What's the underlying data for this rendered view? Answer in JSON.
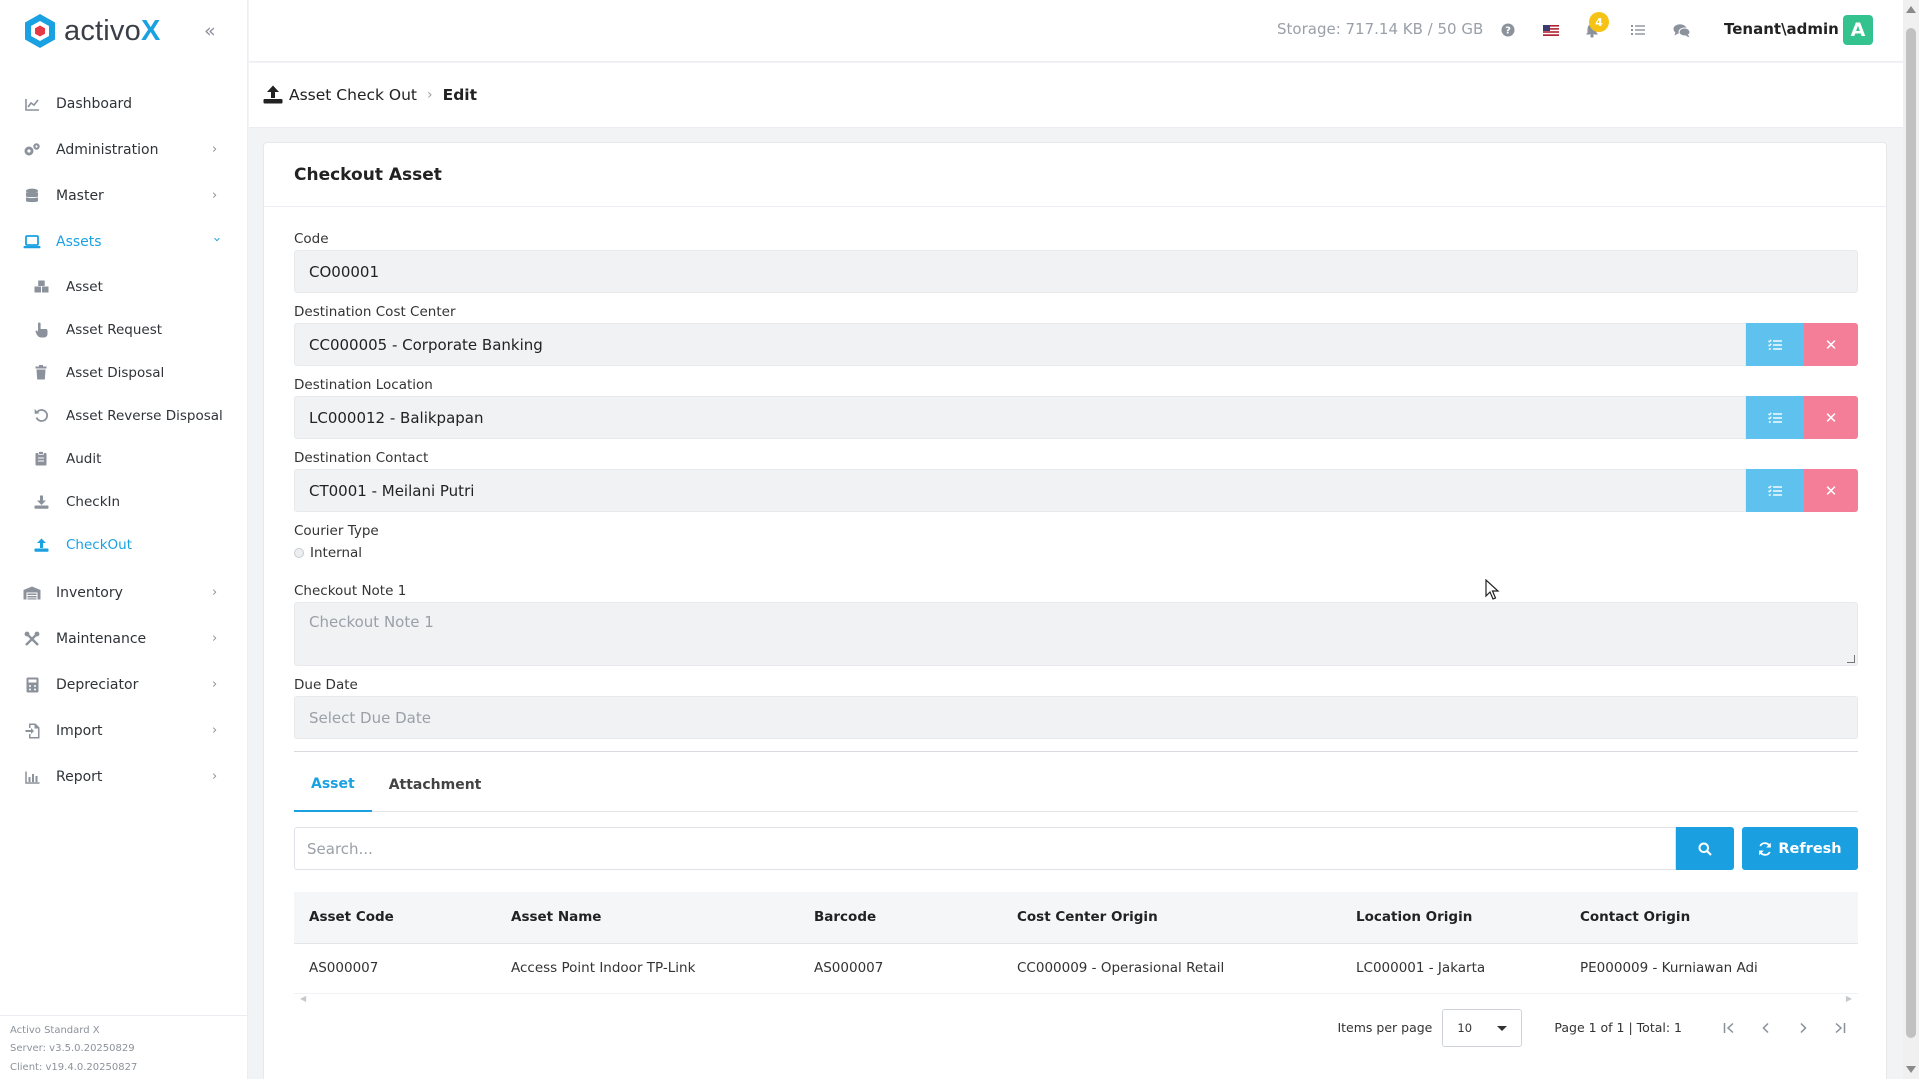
{
  "app": {
    "logo_text": "activo",
    "logo_x": "X",
    "brand_color": "#1aa1e1"
  },
  "sidebar": {
    "items": [
      {
        "label": "Dashboard",
        "icon": "chart-line-icon",
        "has_children": false
      },
      {
        "label": "Administration",
        "icon": "gears-icon",
        "has_children": true
      },
      {
        "label": "Master",
        "icon": "database-icon",
        "has_children": true
      },
      {
        "label": "Assets",
        "icon": "laptop-icon",
        "has_children": true,
        "expanded": true,
        "active": true
      }
    ],
    "assets_children": [
      {
        "label": "Asset",
        "icon": "boxes-icon"
      },
      {
        "label": "Asset Request",
        "icon": "hand-pointer-icon"
      },
      {
        "label": "Asset Disposal",
        "icon": "trash-icon"
      },
      {
        "label": "Asset Reverse Disposal",
        "icon": "undo-icon"
      },
      {
        "label": "Audit",
        "icon": "clipboard-icon"
      },
      {
        "label": "CheckIn",
        "icon": "download-icon"
      },
      {
        "label": "CheckOut",
        "icon": "upload-icon",
        "active": true
      }
    ],
    "items_after": [
      {
        "label": "Inventory",
        "icon": "warehouse-icon"
      },
      {
        "label": "Maintenance",
        "icon": "tools-icon"
      },
      {
        "label": "Depreciator",
        "icon": "calculator-icon"
      },
      {
        "label": "Import",
        "icon": "file-import-icon"
      },
      {
        "label": "Report",
        "icon": "chart-bar-icon"
      }
    ],
    "version": {
      "product": "Activo Standard X",
      "server": "Server: v3.5.0.20250829",
      "client": "Client: v19.4.0.20250827"
    }
  },
  "topbar": {
    "storage": "Storage: 717.14 KB / 50 GB",
    "notification_count": "4",
    "user": "Tenant\\admin",
    "avatar_letter": "A",
    "avatar_color": "#34c38f"
  },
  "breadcrumb": {
    "parent": "Asset Check Out",
    "current": "Edit"
  },
  "card": {
    "title": "Checkout Asset"
  },
  "form": {
    "code": {
      "label": "Code",
      "value": "CO00001"
    },
    "cost_center": {
      "label": "Destination Cost Center",
      "value": "CC000005 - Corporate Banking"
    },
    "location": {
      "label": "Destination Location",
      "value": "LC000012 - Balikpapan"
    },
    "contact": {
      "label": "Destination Contact",
      "value": "CT0001 - Meilani Putri"
    },
    "courier_type": {
      "label": "Courier Type",
      "option": "Internal"
    },
    "note": {
      "label": "Checkout Note 1",
      "placeholder": "Checkout Note 1"
    },
    "due_date": {
      "label": "Due Date",
      "placeholder": "Select Due Date"
    }
  },
  "tabs": [
    {
      "label": "Asset",
      "active": true
    },
    {
      "label": "Attachment",
      "active": false
    }
  ],
  "table_toolbar": {
    "search_placeholder": "Search...",
    "refresh_label": "Refresh"
  },
  "table": {
    "columns": [
      "Asset Code",
      "Asset Name",
      "Barcode",
      "Cost Center Origin",
      "Location Origin",
      "Contact Origin"
    ],
    "rows": [
      [
        "AS000007",
        "Access Point Indoor TP-Link",
        "AS000007",
        "CC000009 - Operasional Retail",
        "LC000001 - Jakarta",
        "PE000009 - Kurniawan Adi"
      ]
    ]
  },
  "pagination": {
    "items_per_page_label": "Items per page",
    "items_per_page": "10",
    "range": "Page 1 of 1 | Total: 1"
  }
}
